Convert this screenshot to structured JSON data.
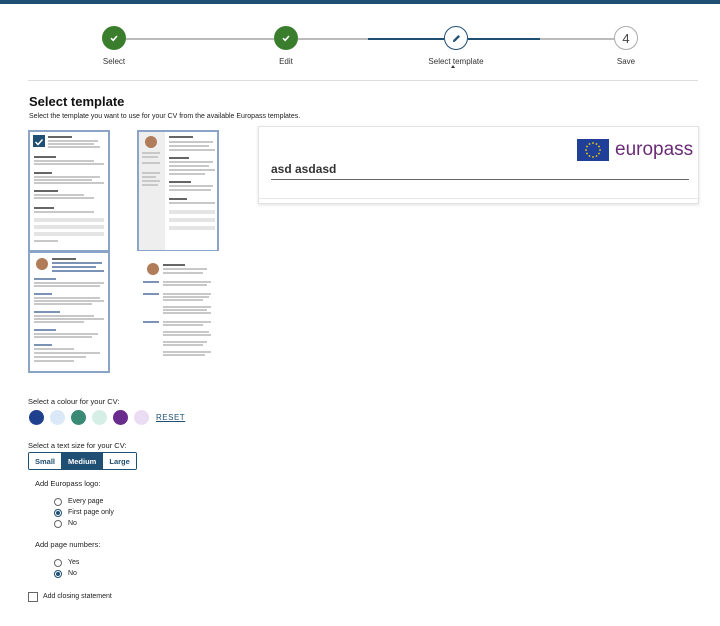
{
  "stepper": {
    "steps": [
      {
        "label": "Select",
        "state": "done"
      },
      {
        "label": "Edit",
        "state": "done"
      },
      {
        "label": "Select template",
        "state": "active"
      },
      {
        "label": "Save",
        "state": "todo",
        "number": "4"
      }
    ]
  },
  "page": {
    "title": "Select template",
    "subtitle": "Select the template you want to use for your CV from the available Europass templates."
  },
  "preview": {
    "brand": "europass",
    "name": "asd asdasd"
  },
  "colour": {
    "label": "Select a colour for your CV:",
    "swatches": [
      "#1f3f8f",
      "#dbe8f8",
      "#3a8a75",
      "#d6efe6",
      "#6a2c8c",
      "#eadcf3"
    ],
    "reset_label": "RESET"
  },
  "text_size": {
    "label": "Select a text size for your CV:",
    "options": [
      "Small",
      "Medium",
      "Large"
    ],
    "selected": "Medium"
  },
  "logo": {
    "label": "Add Europass logo:",
    "options": [
      "Every page",
      "First page only",
      "No"
    ],
    "selected": "First page only"
  },
  "page_numbers": {
    "label": "Add page numbers:",
    "options": [
      "Yes",
      "No"
    ],
    "selected": "No"
  },
  "closing": {
    "label": "Add closing statement",
    "checked": false
  },
  "colors": {
    "done": "#3a7d2c",
    "accent": "#1f4f72",
    "brand": "#6b2c77"
  }
}
